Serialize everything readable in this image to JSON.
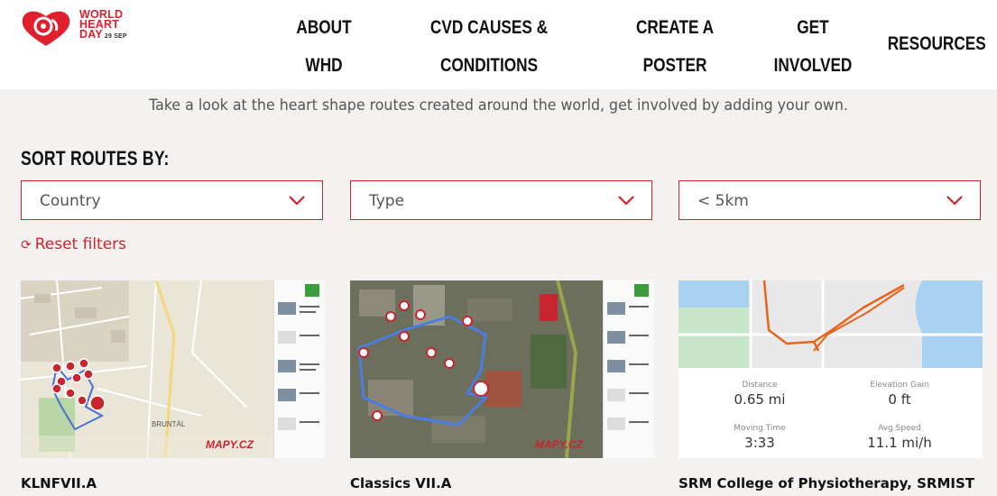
{
  "header": {
    "logo": {
      "line1": "WORLD",
      "line2": "HEART",
      "line3": "DAY",
      "date": "29 SEP"
    },
    "nav": [
      {
        "line1": "ABOUT",
        "line2": "WHD"
      },
      {
        "line1": "CVD CAUSES &",
        "line2": "CONDITIONS"
      },
      {
        "line1": "CREATE A",
        "line2": "POSTER"
      },
      {
        "line1": "GET",
        "line2": "INVOLVED"
      },
      {
        "line1": "RESOURCES",
        "line2": ""
      }
    ]
  },
  "intro": "Take a look at the heart shape routes created around the world, get involved by adding your own.",
  "sort": {
    "title": "SORT ROUTES BY:",
    "filters": [
      {
        "value": "Country"
      },
      {
        "value": "Type"
      },
      {
        "value": "< 5km"
      }
    ],
    "reset_label": "Reset filters"
  },
  "cards": [
    {
      "title": "KLNFVII.A",
      "map_label": "BRUNTÁL",
      "brand": "MAPY.CZ"
    },
    {
      "title": "Classics VII.A",
      "brand": "MAPY.CZ"
    },
    {
      "title": "SRM College of Physiotherapy, SRMIST",
      "stats": [
        {
          "label": "Distance",
          "value": "0.65 mi"
        },
        {
          "label": "Elevation Gain",
          "value": "0 ft"
        },
        {
          "label": "Moving Time",
          "value": "3:33"
        },
        {
          "label": "Avg Speed",
          "value": "11.1 mi/h"
        }
      ]
    }
  ],
  "colors": {
    "brand_red": "#e0202e",
    "accent_red": "#c9252f",
    "content_bg": "#f3f2f1"
  }
}
